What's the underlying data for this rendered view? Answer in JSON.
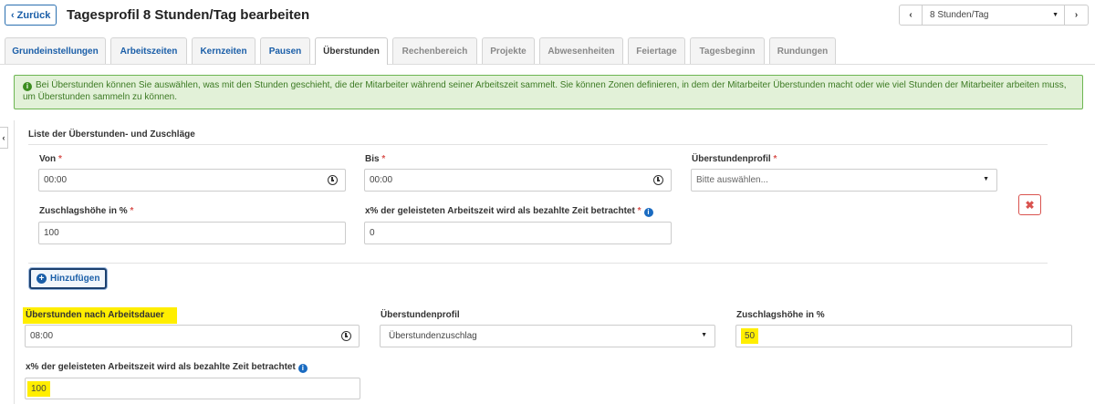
{
  "header": {
    "back_label": "Zurück",
    "title": "Tagesprofil 8 Stunden/Tag bearbeiten",
    "profile_value": "8 Stunden/Tag"
  },
  "tabs": [
    {
      "label": "Grundeinstellungen",
      "state": "enabled"
    },
    {
      "label": "Arbeitszeiten",
      "state": "enabled"
    },
    {
      "label": "Kernzeiten",
      "state": "enabled"
    },
    {
      "label": "Pausen",
      "state": "enabled"
    },
    {
      "label": "Überstunden",
      "state": "active"
    },
    {
      "label": "Rechenbereich",
      "state": "disabled"
    },
    {
      "label": "Projekte",
      "state": "disabled"
    },
    {
      "label": "Abwesenheiten",
      "state": "disabled"
    },
    {
      "label": "Feiertage",
      "state": "disabled"
    },
    {
      "label": "Tagesbeginn",
      "state": "disabled"
    },
    {
      "label": "Rundungen",
      "state": "disabled"
    }
  ],
  "alert": {
    "text": "Bei Überstunden können Sie auswählen, was mit den Stunden geschieht, die der Mitarbeiter während seiner Arbeitszeit sammelt. Sie können Zonen definieren, in dem der Mitarbeiter Überstunden macht oder wie viel Stunden der Mitarbeiter arbeiten muss, um Überstunden sammeln zu können."
  },
  "list": {
    "title": "Liste der Überstunden- und Zuschläge",
    "von_label": "Von",
    "von_value": "00:00",
    "bis_label": "Bis",
    "bis_value": "00:00",
    "profil_label": "Überstundenprofil",
    "profil_placeholder": "Bitte auswählen...",
    "zuschlag_label": "Zuschlagshöhe in %",
    "zuschlag_value": "100",
    "bezahlt_label": "x% der geleisteten Arbeitszeit wird als bezahlte Zeit betrachtet",
    "bezahlt_value": "0",
    "required_marker": "*",
    "add_label": "Hinzufügen"
  },
  "duration": {
    "nach_label": "Überstunden nach Arbeitsdauer",
    "nach_value": "08:00",
    "profil_label": "Überstundenprofil",
    "profil_value": "Überstundenzuschlag",
    "zuschlag_label": "Zuschlagshöhe in %",
    "zuschlag_value": "50",
    "bezahlt_label": "x% der geleisteten Arbeitszeit wird als bezahlte Zeit betrachtet",
    "bezahlt_value": "100"
  },
  "icons": {
    "back": "chevron-left-icon",
    "prev": "chevron-left-icon",
    "next": "chevron-right-icon",
    "alert": "info-circle-icon",
    "clock": "clock-icon",
    "delete": "close-icon",
    "add": "plus-circle-icon",
    "help": "info-circle-icon"
  },
  "colors": {
    "link": "#1a5ea8",
    "alert_bg": "#e2f1d8",
    "alert_border": "#6db652",
    "danger": "#d9534f",
    "highlight": "#ffee00"
  }
}
